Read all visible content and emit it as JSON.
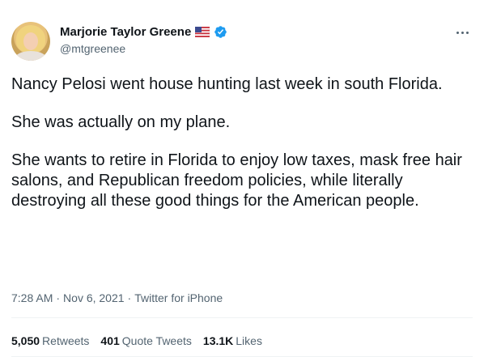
{
  "author": {
    "display_name": "Marjorie Taylor Greene",
    "handle": "@mtgreenee",
    "flag_icon": "us-flag-icon",
    "verified_icon": "verified-badge-icon"
  },
  "tweet": {
    "paragraphs": [
      "Nancy Pelosi went house hunting last week in south Florida.",
      "She was actually on my plane.",
      "She wants to retire in Florida to enjoy low taxes, mask free hair salons, and Republican freedom policies, while literally destroying all these good things for the American people."
    ],
    "time": "7:28 AM",
    "date": "Nov 6, 2021",
    "source": "Twitter for iPhone"
  },
  "stats": {
    "retweets_count": "5,050",
    "retweets_label": "Retweets",
    "quotes_count": "401",
    "quotes_label": "Quote Tweets",
    "likes_count": "13.1K",
    "likes_label": "Likes"
  },
  "colors": {
    "text": "#0f1419",
    "secondary": "#536471",
    "verified": "#1d9bf0"
  }
}
